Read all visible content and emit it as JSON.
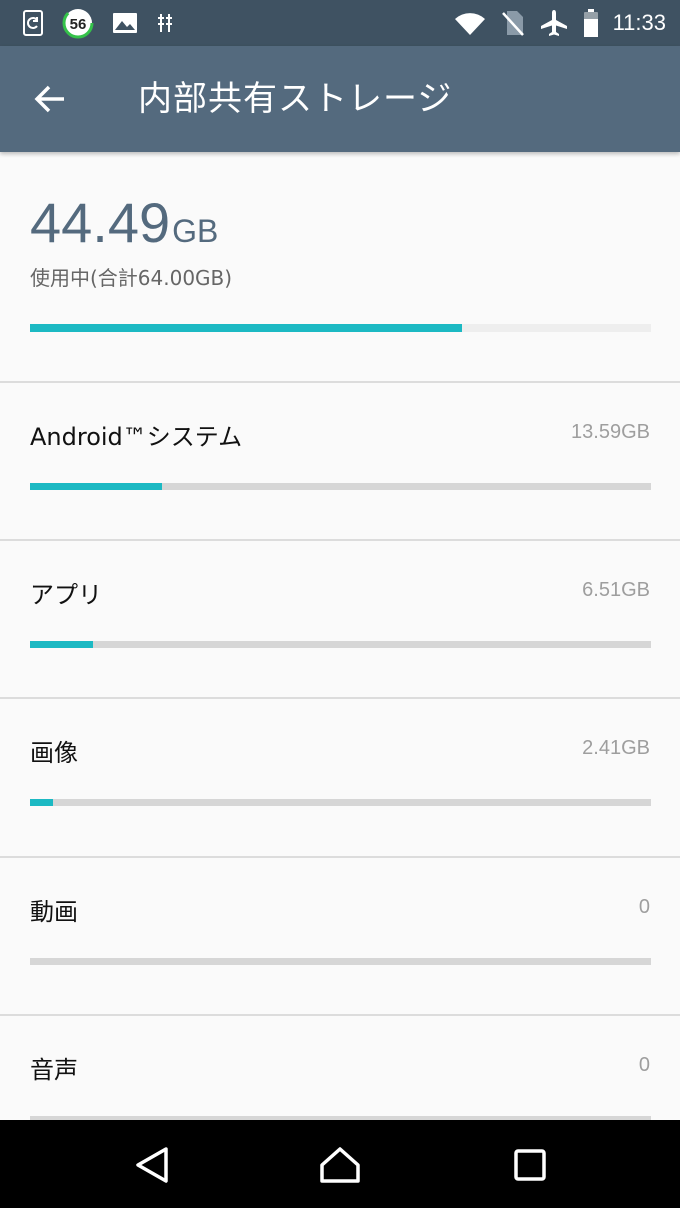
{
  "status_bar": {
    "left_icons": [
      "sync-icon",
      "battery-badge-icon",
      "image-icon",
      "usb-debug-icon"
    ],
    "badge_number": "56",
    "right_icons": [
      "wifi-icon",
      "no-sim-icon",
      "airplane-icon",
      "battery-icon"
    ],
    "time": "11:33"
  },
  "app_bar": {
    "back_icon": "arrow-left-icon",
    "title": "内部共有ストレージ"
  },
  "summary": {
    "used_number": "44.49",
    "used_unit": "GB",
    "subtitle": "使用中(合計64.00GB)",
    "used_fraction": 0.695
  },
  "items": [
    {
      "label": "Android™システム",
      "size": "13.59GB",
      "fraction": 0.2123
    },
    {
      "label": "アプリ",
      "size": "6.51GB",
      "fraction": 0.1017
    },
    {
      "label": "画像",
      "size": "2.41GB",
      "fraction": 0.0377
    },
    {
      "label": "動画",
      "size": "0",
      "fraction": 0
    },
    {
      "label": "音声",
      "size": "0",
      "fraction": 0
    }
  ],
  "nav_bar": {
    "icons": [
      "back-triangle-icon",
      "home-icon",
      "recents-icon"
    ]
  },
  "colors": {
    "status_bar": "#3f5262",
    "app_bar": "#546a7e",
    "accent": "#1cb9c3"
  }
}
